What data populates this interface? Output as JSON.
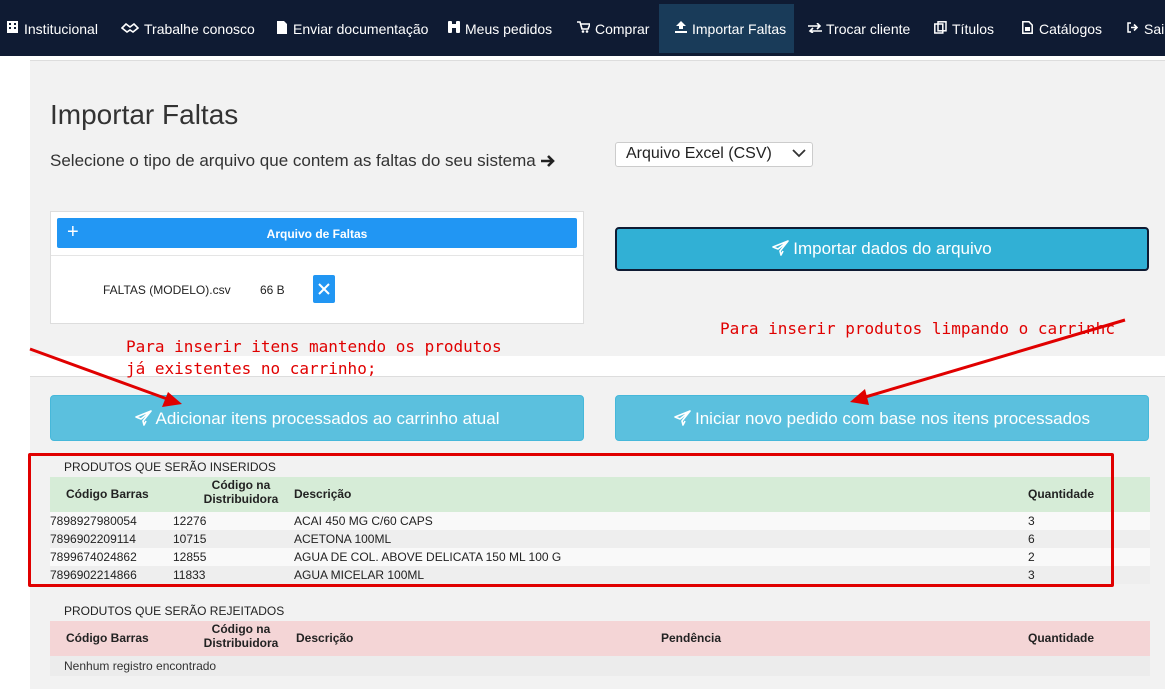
{
  "nav": {
    "items": [
      {
        "label": "Institucional",
        "icon": "institution-icon"
      },
      {
        "label": "Trabalhe conosco",
        "icon": "handshake-icon"
      },
      {
        "label": "Enviar documentação",
        "icon": "file-icon"
      },
      {
        "label": "Meus pedidos",
        "icon": "binoculars-icon"
      },
      {
        "label": "Comprar",
        "icon": "cart-icon"
      },
      {
        "label": "Importar Faltas",
        "icon": "upload-icon"
      },
      {
        "label": "Trocar cliente",
        "icon": "exchange-icon"
      },
      {
        "label": "Títulos",
        "icon": "copy-icon"
      },
      {
        "label": "Catálogos",
        "icon": "pdf-file-icon"
      },
      {
        "label": "Sai",
        "icon": "sign-out-icon"
      }
    ],
    "active": "Importar Faltas",
    "bg_color": "#0f1b33",
    "active_color": "#193b59"
  },
  "page": {
    "title": "Importar Faltas",
    "subtitle": "Selecione o tipo de arquivo que contem as faltas do seu sistema",
    "file_type_selected": "Arquivo Excel (CSV)"
  },
  "upload": {
    "header_label": "Arquivo de Faltas",
    "file_name": "FALTAS (MODELO).csv",
    "file_size": "66 B",
    "accent": "#2196f3"
  },
  "buttons": {
    "import": "Importar dados do arquivo",
    "add_to_cart": "Adicionar itens processados ao carrinho atual",
    "new_order": "Iniciar novo pedido com base nos itens processados"
  },
  "annotations": {
    "left_note": "Para inserir itens mantendo os produtos já existentes no carrinho;",
    "right_note": "Para inserir produtos limpando o carrinhc",
    "color": "#e00000"
  },
  "inserted": {
    "section_title": "PRODUTOS QUE SERÃO INSERIDOS",
    "headers": {
      "barcode": "Código Barras",
      "dist_code_1": "Código na",
      "dist_code_2": "Distribuidora",
      "description": "Descrição",
      "quantity": "Quantidade"
    },
    "rows": [
      {
        "barcode": "7898927980054",
        "dist_code": "12276",
        "description": "ACAI 450 MG C/60 CAPS",
        "quantity": "3"
      },
      {
        "barcode": "7896902209114",
        "dist_code": "10715",
        "description": "ACETONA 100ML",
        "quantity": "6"
      },
      {
        "barcode": "7899674024862",
        "dist_code": "12855",
        "description": "AGUA DE COL. ABOVE DELICATA 150 ML 100 G",
        "quantity": "2"
      },
      {
        "barcode": "7896902214866",
        "dist_code": "11833",
        "description": "AGUA MICELAR 100ML",
        "quantity": "3"
      }
    ]
  },
  "rejected": {
    "section_title": "PRODUTOS QUE SERÃO REJEITADOS",
    "headers": {
      "barcode": "Código Barras",
      "dist_code_1": "Código na",
      "dist_code_2": "Distribuidora",
      "description": "Descrição",
      "pending": "Pendência",
      "quantity": "Quantidade"
    },
    "empty_message": "Nenhum registro encontrado"
  }
}
